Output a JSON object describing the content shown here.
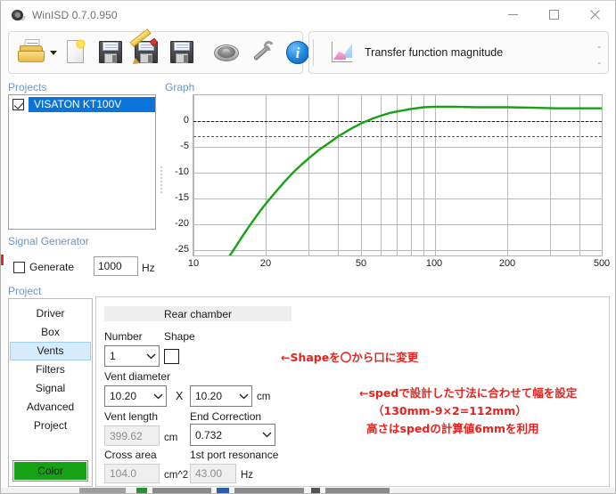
{
  "window": {
    "title": "WinISD 0.7.0.950",
    "icon": "speaker-icon",
    "controls": {
      "minimize": "minimize-icon",
      "maximize": "maximize-icon",
      "close": "close-icon"
    }
  },
  "toolbar": {
    "items": [
      {
        "name": "open-project",
        "icon": "open-folder-icon",
        "has_dropdown": true
      },
      {
        "name": "new-project",
        "icon": "new-document-icon",
        "has_dropdown": false
      },
      {
        "name": "save-project",
        "icon": "floppy-save-icon",
        "has_dropdown": false
      },
      {
        "name": "edit-save-project",
        "icon": "floppy-pencil-icon",
        "has_dropdown": false
      },
      {
        "name": "save-as-project",
        "icon": "floppy-save-as-icon",
        "has_dropdown": false
      },
      {
        "name": "driver-editor",
        "icon": "speaker-driver-icon",
        "has_dropdown": false
      },
      {
        "name": "preferences",
        "icon": "wrench-icon",
        "has_dropdown": false
      },
      {
        "name": "about",
        "icon": "info-icon",
        "has_dropdown": true
      }
    ],
    "graph_group": {
      "icon": "transfer-function-chart-icon",
      "label": "Transfer function magnitude",
      "dash_top": "-",
      "dash_bottom": "-"
    }
  },
  "sections": {
    "projects": "Projects",
    "graph": "Graph",
    "signal_generator": "Signal Generator",
    "project": "Project"
  },
  "projects": {
    "items": [
      {
        "label": "VISATON KT100V",
        "checked": true,
        "selected": true
      }
    ]
  },
  "signal_generator": {
    "generate_label": "Generate",
    "generate_checked": false,
    "frequency_value": "1000",
    "frequency_unit": "Hz"
  },
  "project_nav": {
    "items": [
      {
        "label": "Driver",
        "selected": false
      },
      {
        "label": "Box",
        "selected": false
      },
      {
        "label": "Vents",
        "selected": true
      },
      {
        "label": "Filters",
        "selected": false
      },
      {
        "label": "Signal",
        "selected": false
      },
      {
        "label": "Advanced",
        "selected": false
      },
      {
        "label": "Project",
        "selected": false
      }
    ],
    "color_button": "Color"
  },
  "vents": {
    "tab_label": "Rear chamber",
    "number_label": "Number",
    "number_value": "1",
    "shape_label": "Shape",
    "shape_checked": false,
    "vent_diameter_label": "Vent diameter",
    "vent_diameter_a": "10.20",
    "vent_diameter_b": "10.20",
    "vent_diameter_multiplier": "X",
    "vent_diameter_unit": "cm",
    "vent_length_label": "Vent length",
    "vent_length_value": "399.62",
    "vent_length_unit": "cm",
    "end_correction_label": "End Correction",
    "end_correction_value": "0.732",
    "cross_area_label": "Cross area",
    "cross_area_value": "104.0",
    "cross_area_unit": "cm^2",
    "port_resonance_label": "1st port resonance",
    "port_resonance_value": "43.00",
    "port_resonance_unit": "Hz"
  },
  "annotations": {
    "shape_note": "←Shapeを〇から口に変更",
    "line1": "←spedで設計した寸法に合わせて幅を設定",
    "line2": "（130mm-9×2=112mm）",
    "line3": "高さはspedの計算値6mmを利用",
    "color": "#e8231e"
  },
  "chart_data": {
    "type": "line",
    "title": "Transfer function magnitude",
    "xlabel": "",
    "ylabel": "",
    "xscale": "log",
    "xlim": [
      10,
      500
    ],
    "ylim": [
      -28.5,
      2.5
    ],
    "xticks": [
      10,
      20,
      50,
      100,
      200,
      500
    ],
    "xtick_labels": [
      "10",
      "20",
      "50",
      "100",
      "200",
      "500"
    ],
    "yticks": [
      0,
      -5,
      -10,
      -15,
      -20,
      -25
    ],
    "ytick_labels": [
      "0",
      "-5",
      "-10",
      "-15",
      "-20",
      "-25"
    ],
    "grid": true,
    "legend": "none",
    "reference_lines": [
      {
        "y": 0,
        "style": "dashed",
        "color": "#1c1c1c"
      },
      {
        "y": -3,
        "style": "dashed",
        "color": "#5a5a5a"
      }
    ],
    "series": [
      {
        "name": "VISATON KT100V",
        "color": "#16a215",
        "x": [
          14.0,
          15,
          16,
          17,
          18,
          19,
          20,
          22,
          24,
          26,
          28,
          30,
          33,
          36,
          40,
          45,
          50,
          55,
          60,
          65,
          70,
          80,
          90,
          100,
          120,
          150,
          200,
          260,
          320,
          400,
          500
        ],
        "y": [
          -28.5,
          -26.4,
          -24.4,
          -22.6,
          -21.0,
          -19.5,
          -18.2,
          -15.9,
          -13.9,
          -12.2,
          -10.8,
          -9.6,
          -8.0,
          -6.8,
          -5.3,
          -3.9,
          -2.8,
          -2.0,
          -1.4,
          -0.9,
          -0.6,
          -0.1,
          0.2,
          0.3,
          0.3,
          0.2,
          0.2,
          0.1,
          0.0,
          0.0,
          0.0
        ]
      }
    ]
  }
}
